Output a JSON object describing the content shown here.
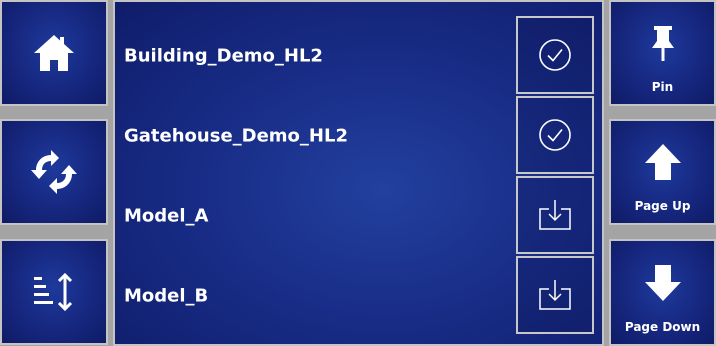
{
  "left_toolbar": {
    "home_icon": "home-icon",
    "sync_icon": "sync-icon",
    "sort_icon": "sort-icon"
  },
  "model_list": {
    "items": [
      {
        "name": "Building_Demo_HL2",
        "status_icon": "checkmark-circle-icon"
      },
      {
        "name": "Gatehouse_Demo_HL2",
        "status_icon": "checkmark-circle-icon"
      },
      {
        "name": "Model_A",
        "status_icon": "download-icon"
      },
      {
        "name": "Model_B",
        "status_icon": "download-icon"
      }
    ]
  },
  "right_toolbar": {
    "pin_label": "Pin",
    "page_up_label": "Page Up",
    "page_down_label": "Page Down"
  },
  "colors": {
    "panel_background": "#16277f",
    "border": "#c4c4c4",
    "text": "#ffffff",
    "gutter": "#a4a4a4"
  }
}
